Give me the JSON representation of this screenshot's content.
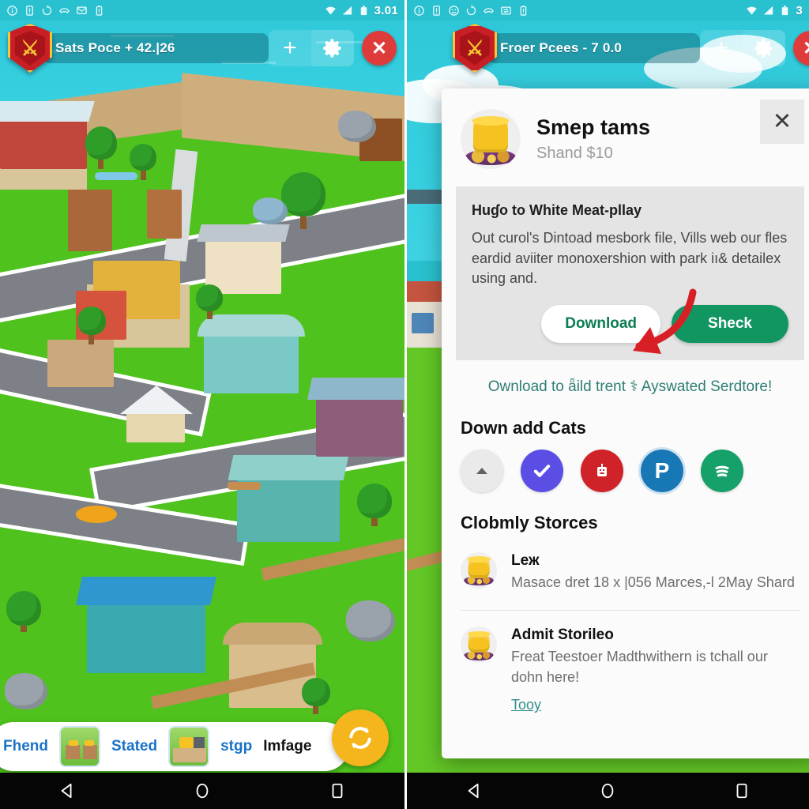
{
  "left_phone": {
    "status_bar": {
      "time": "3.01",
      "icons": [
        "info-icon",
        "sim-icon",
        "sync-icon",
        "call-icon",
        "message-icon",
        "battery-alert-icon"
      ],
      "right_icons": [
        "wifi-icon",
        "signal-icon",
        "battery-icon"
      ]
    },
    "header": {
      "crest_icon": "shield-crest-icon",
      "url_text": "Sats Poce + 42.|26",
      "plus_label": "+",
      "gear_icon": "gear-icon",
      "close_label": "✕"
    },
    "bottom_bar": {
      "label_1": "Fhend",
      "label_2": "Stated",
      "label_3": "stgp",
      "label_4": "Imfage",
      "fab_icon": "refresh-sync-icon"
    },
    "nav": {
      "back": "back-icon",
      "home": "home-icon",
      "recents": "recents-icon"
    }
  },
  "right_phone": {
    "status_bar": {
      "time": "3",
      "icons": [
        "info-icon",
        "sim-icon",
        "face-icon",
        "sync-icon",
        "call-icon",
        "transfer-icon",
        "battery-alert-icon"
      ],
      "right_icons": [
        "wifi-icon",
        "signal-icon",
        "battery-icon"
      ]
    },
    "header": {
      "crest_icon": "shield-crest-icon",
      "url_text": "Froer Pcees - 7 0.0",
      "plus_label": "+",
      "gear_icon": "gear-icon"
    },
    "dialog": {
      "close_label": "✕",
      "app_icon": "coin-stack-icon",
      "title": "Smep tams",
      "subtitle": "Shand $10",
      "info": {
        "heading": "Huɠo to White Meat-pllay",
        "body": "Out curol's Dintoad mesbork file, Vills web our fles eardid aviiter monoxershion with park iı& detailex using and.",
        "secondary_button": "Download",
        "primary_button": "Sheck"
      },
      "promo_text": "Ownload to  ǟild trent ⚕ Ayswated Serdtore!",
      "section_apps_title": "Down add Cats",
      "chips": [
        {
          "name": "triangle-up-icon",
          "color": "#eaeaea",
          "glyph": "▲",
          "glyph_color": "#5d6368"
        },
        {
          "name": "check-circle-icon",
          "color": "#5b4ee5",
          "glyph": "✔",
          "glyph_color": "#ffffff"
        },
        {
          "name": "robot-icon",
          "color": "#cf2229",
          "glyph": "☣",
          "glyph_color": "#ffffff"
        },
        {
          "name": "paypal-p-icon",
          "color": "#1878b5",
          "glyph": "P",
          "glyph_color": "#ffffff"
        },
        {
          "name": "spotify-icon",
          "color": "#16a06a",
          "glyph": "≡",
          "glyph_color": "#ffffff"
        }
      ],
      "section_list_title": "Clobmly Storces",
      "list": [
        {
          "icon": "coin-stack-icon",
          "title": "Leж",
          "desc": "Masace dret 18 x |056 Marces,-l 2May Shard",
          "link": ""
        },
        {
          "icon": "coin-stack-icon",
          "title": "Admit Storileo",
          "desc": "Freat Teestoer Madthwithern is tchall our dohn here!",
          "link": "Tooy"
        }
      ]
    },
    "nav": {
      "back": "back-icon",
      "home": "home-icon",
      "recents": "recents-icon"
    }
  },
  "colors": {
    "sky": "#2ec7d8",
    "grass": "#4fc21d",
    "road": "#7d8187",
    "accent_green": "#119661",
    "crest_red": "#c81f24",
    "fab_orange": "#f5b61d",
    "arrow_red": "#d81f26"
  }
}
